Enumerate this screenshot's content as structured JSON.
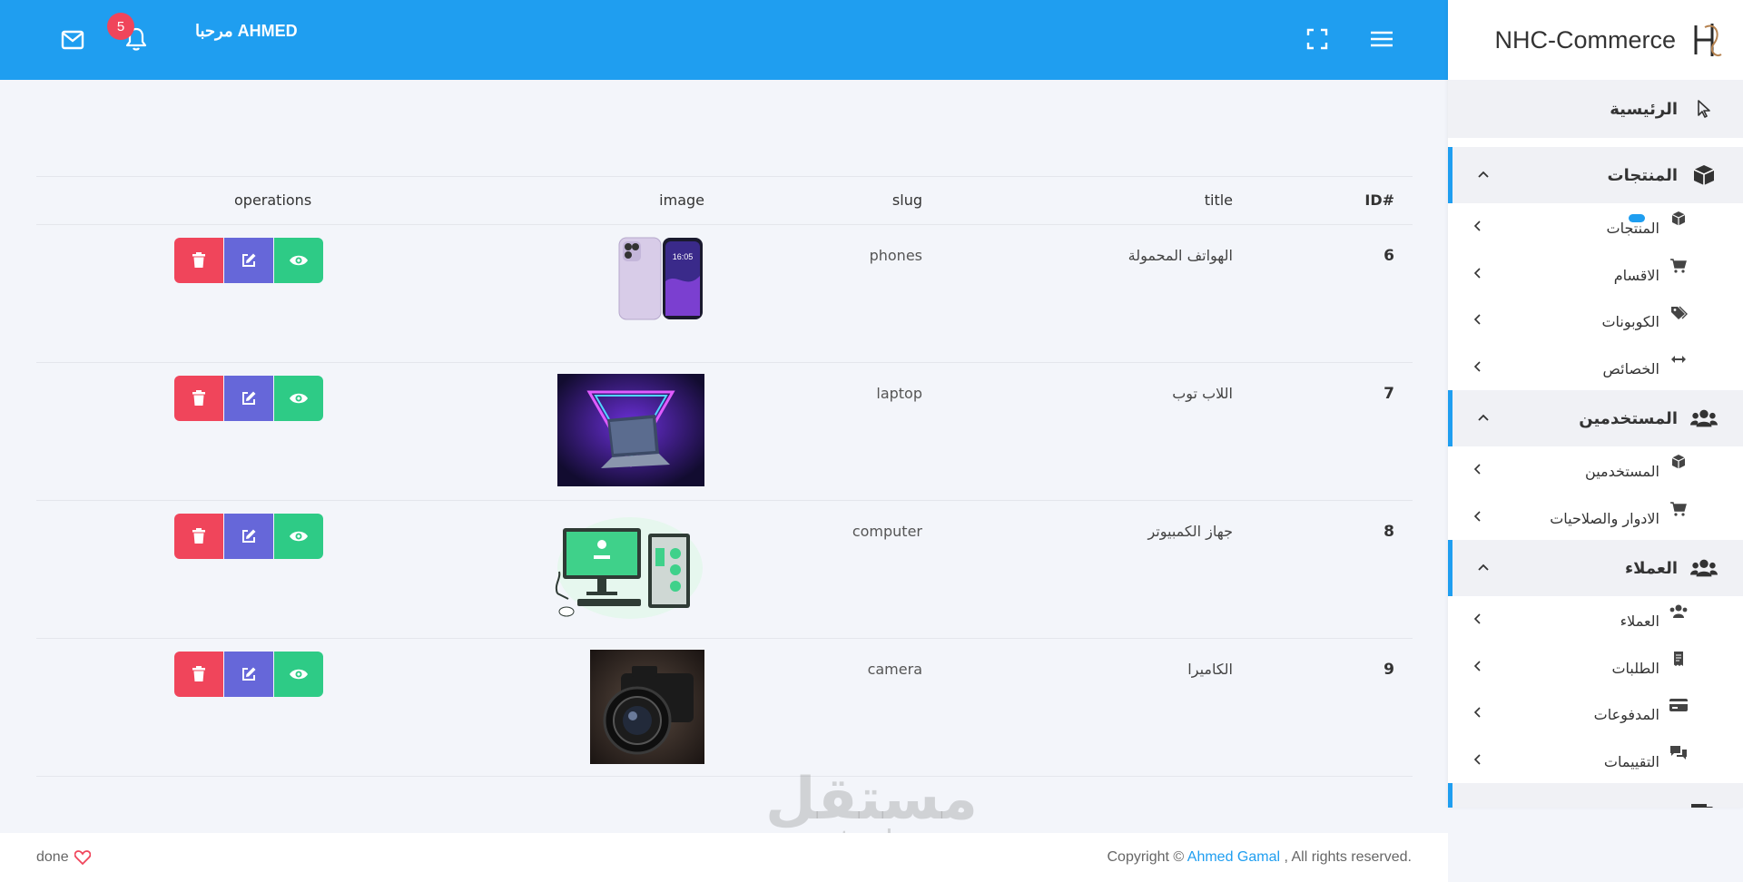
{
  "header": {
    "greeting": "مرحبا AHMED",
    "notifications_count": "5"
  },
  "brand": {
    "name": "NHC-Commerce"
  },
  "sidebar": {
    "home": "الرئيسية",
    "sections": [
      {
        "label": "المنتجات",
        "items": [
          "المنتجات",
          "الاقسام",
          "الكوبونات",
          "الخصائص"
        ]
      },
      {
        "label": "المستخدمين",
        "items": [
          "المستخدمين",
          "الادوار والصلاحيات"
        ]
      },
      {
        "label": "العملاء",
        "items": [
          "العملاء",
          "الطلبات",
          "المدفوعات",
          "التقييمات"
        ]
      }
    ]
  },
  "table": {
    "headers": {
      "id": "ID#",
      "title": "title",
      "slug": "slug",
      "image": "image",
      "operations": "operations"
    },
    "rows": [
      {
        "id": "6",
        "title": "الهواتف المحمولة",
        "slug": "phones"
      },
      {
        "id": "7",
        "title": "اللاب توب",
        "slug": "laptop"
      },
      {
        "id": "8",
        "title": "جهاز الكمبيوتر",
        "slug": "computer"
      },
      {
        "id": "9",
        "title": "الكاميرا",
        "slug": "camera"
      }
    ]
  },
  "footer": {
    "left": "done",
    "right_prefix": "Copyright © ",
    "author": "Ahmed Gamal",
    "right_suffix": " , All rights reserved."
  },
  "watermark": {
    "arabic": "مستقل",
    "latin": "mostaql.com"
  },
  "colors": {
    "primary": "#1f9ef0",
    "danger": "#f0455b",
    "edit": "#6667d9",
    "success": "#2ecb86"
  }
}
